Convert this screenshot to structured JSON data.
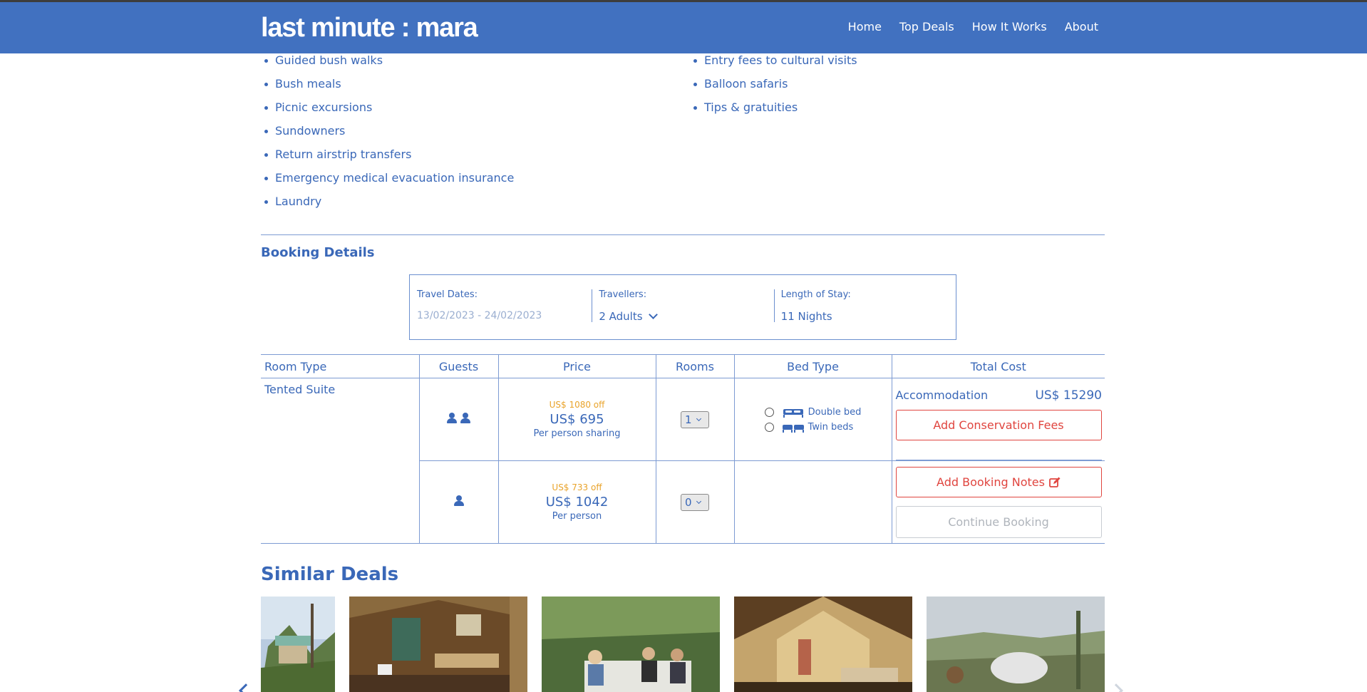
{
  "header": {
    "brand": "last minute : mara",
    "nav": [
      "Home",
      "Top Deals",
      "How It Works",
      "About"
    ]
  },
  "inclusions": {
    "left": [
      "Guided bush walks",
      "Bush meals",
      "Picnic excursions",
      "Sundowners",
      "Return airstrip transfers",
      "Emergency medical evacuation insurance",
      "Laundry"
    ],
    "right": [
      "Entry fees to cultural visits",
      "Balloon safaris",
      "Tips & gratuities"
    ]
  },
  "booking": {
    "title": "Booking Details",
    "travel_dates_label": "Travel Dates:",
    "travel_dates_value": "13/02/2023 - 24/02/2023",
    "travellers_label": "Travellers:",
    "travellers_value": "2 Adults",
    "length_label": "Length of Stay:",
    "length_value": "11 Nights"
  },
  "table": {
    "headers": [
      "Room Type",
      "Guests",
      "Price",
      "Rooms",
      "Bed Type",
      "Total Cost"
    ],
    "room_type": "Tented Suite",
    "rows": [
      {
        "guests": 2,
        "discount": "US$ 1080 off",
        "price": "US$ 695",
        "price_note": "Per person sharing",
        "rooms": "1"
      },
      {
        "guests": 1,
        "discount": "US$ 733 off",
        "price": "US$ 1042",
        "price_note": "Per person",
        "rooms": "0"
      }
    ],
    "bed_types": [
      "Double bed",
      "Twin beds"
    ]
  },
  "total": {
    "accommodation_label": "Accommodation",
    "accommodation_value": "US$ 15290",
    "conservation_button": "Add Conservation Fees",
    "notes_button": "Add Booking Notes",
    "continue_button": "Continue Booking"
  },
  "similar": {
    "title": "Similar Deals"
  },
  "colors": {
    "brand_blue": "#4171c0",
    "text_blue": "#3a68b8",
    "accent_red": "#e0453f",
    "discount_orange": "#e9a32a"
  }
}
